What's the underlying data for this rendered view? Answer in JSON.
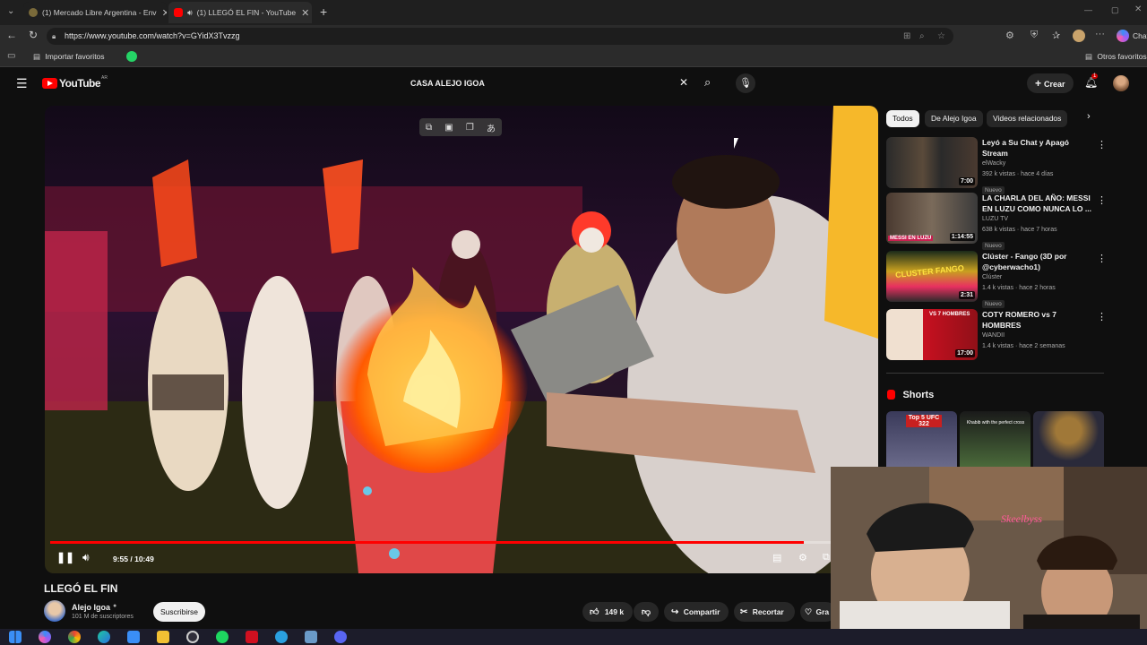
{
  "browser": {
    "tabs": [
      {
        "title": "(1) Mercado Libre Argentina - Env"
      },
      {
        "title": "(1) LLEGÓ EL FIN - YouTube"
      }
    ],
    "url": "https://www.youtube.com/watch?v=GYidX3Tvzzg",
    "favorites_import": "Importar favoritos",
    "other_favorites": "Otros favoritos",
    "copilot_label": "Chat",
    "profile_badge": "1"
  },
  "youtube": {
    "logo_text": "YouTube",
    "region": "AR",
    "search_value": "CASA ALEJO IGOA",
    "create_label": "Crear",
    "notif_count": "1"
  },
  "player": {
    "time": "9:55 / 10:49",
    "progress_fraction": 0.916
  },
  "video": {
    "title": "LLEGÓ EL FIN",
    "channel": "Alejo Igoa",
    "subscribers": "101 M de suscriptores",
    "subscribe_label": "Suscribirse",
    "likes": "149 k",
    "share_label": "Compartir",
    "clip_label": "Recortar",
    "thanks_label": "Gra"
  },
  "sidebar": {
    "chips": [
      "Todos",
      "De Alejo Igoa",
      "Videos relacionados"
    ],
    "videos": [
      {
        "title1": "Leyó a Su Chat y Apagó Stream",
        "title2": "",
        "channel": "elWacky",
        "meta": "392 k vistas · hace 4 días",
        "badge": "Nuevo",
        "duration": "7:00"
      },
      {
        "title1": "LA CHARLA DEL AÑO: MESSI",
        "title2": "EN LUZU COMO NUNCA LO ...",
        "channel": "LUZU TV",
        "meta": "638 k vistas · hace 7 horas",
        "badge": "Nuevo",
        "duration": "1:14:55",
        "thumb_text": "MESSI EN LUZU"
      },
      {
        "title1": "Clúster - Fango (3D por",
        "title2": "@cyberwacho1)",
        "channel": "Clúster",
        "meta": "1.4 k vistas · hace 2 horas",
        "badge": "Nuevo",
        "duration": "2:31",
        "thumb_text": "CLUSTER FANGO"
      },
      {
        "title1": "COTY ROMERO vs 7 HOMBRES",
        "title2": "",
        "channel": "WANDII",
        "meta": "hace 2 semanas",
        "meta_views": "1.4 k vistas",
        "badge": "",
        "duration": "17:00",
        "thumb_text": "VS 7 HOMBRES"
      }
    ],
    "shorts_label": "Shorts",
    "short_texts": [
      "Top 5 UFC 322",
      "Khabib with the perfect cross",
      ""
    ]
  },
  "colors": {
    "yt_red": "#ff0000",
    "bg": "#0f0f0f",
    "chip_active": "#f1f1f1"
  }
}
